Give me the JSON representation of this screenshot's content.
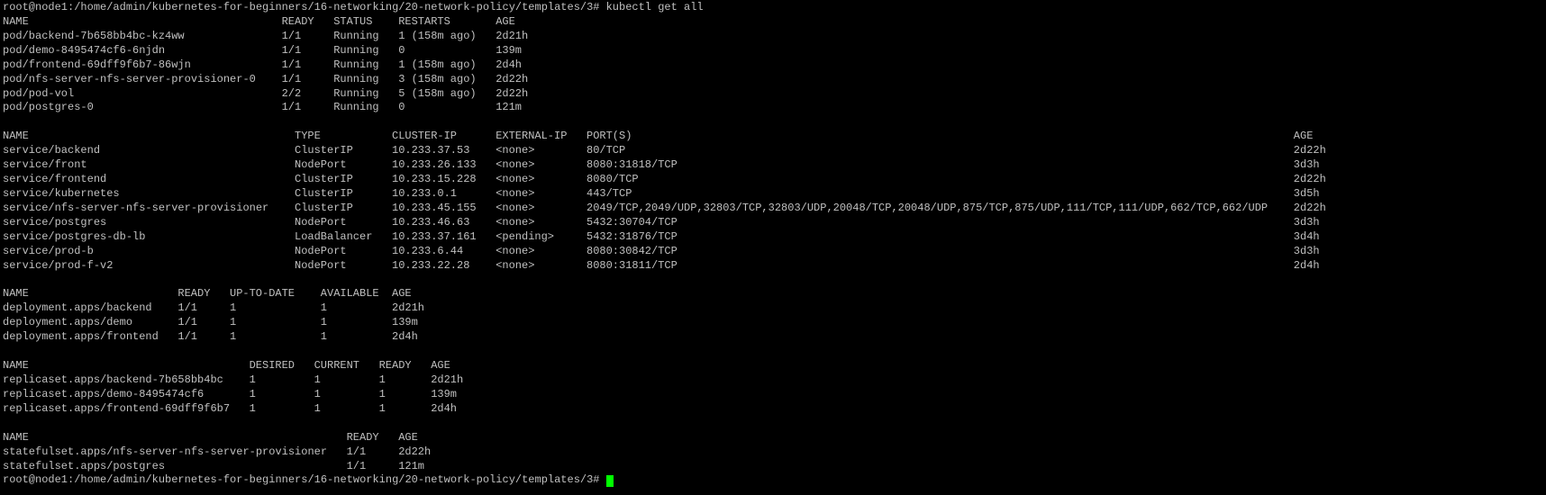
{
  "theme": {
    "background": "#000000",
    "foreground": "#c0c0c0",
    "cursor": "#00ff00"
  },
  "prompt": "root@node1:/home/admin/kubernetes-for-beginners/16-networking/20-network-policy/templates/3#",
  "command": "kubectl get all",
  "pods": {
    "headers": [
      "NAME",
      "READY",
      "STATUS",
      "RESTARTS",
      "AGE"
    ],
    "rows": [
      [
        "pod/backend-7b658bb4bc-kz4ww",
        "1/1",
        "Running",
        "1 (158m ago)",
        "2d21h"
      ],
      [
        "pod/demo-8495474cf6-6njdn",
        "1/1",
        "Running",
        "0",
        "139m"
      ],
      [
        "pod/frontend-69dff9f6b7-86wjn",
        "1/1",
        "Running",
        "1 (158m ago)",
        "2d4h"
      ],
      [
        "pod/nfs-server-nfs-server-provisioner-0",
        "1/1",
        "Running",
        "3 (158m ago)",
        "2d22h"
      ],
      [
        "pod/pod-vol",
        "2/2",
        "Running",
        "5 (158m ago)",
        "2d22h"
      ],
      [
        "pod/postgres-0",
        "1/1",
        "Running",
        "0",
        "121m"
      ]
    ]
  },
  "services": {
    "headers": [
      "NAME",
      "TYPE",
      "CLUSTER-IP",
      "EXTERNAL-IP",
      "PORT(S)",
      "AGE"
    ],
    "rows": [
      [
        "service/backend",
        "ClusterIP",
        "10.233.37.53",
        "<none>",
        "80/TCP",
        "2d22h"
      ],
      [
        "service/front",
        "NodePort",
        "10.233.26.133",
        "<none>",
        "8080:31818/TCP",
        "3d3h"
      ],
      [
        "service/frontend",
        "ClusterIP",
        "10.233.15.228",
        "<none>",
        "8080/TCP",
        "2d22h"
      ],
      [
        "service/kubernetes",
        "ClusterIP",
        "10.233.0.1",
        "<none>",
        "443/TCP",
        "3d5h"
      ],
      [
        "service/nfs-server-nfs-server-provisioner",
        "ClusterIP",
        "10.233.45.155",
        "<none>",
        "2049/TCP,2049/UDP,32803/TCP,32803/UDP,20048/TCP,20048/UDP,875/TCP,875/UDP,111/TCP,111/UDP,662/TCP,662/UDP",
        "2d22h"
      ],
      [
        "service/postgres",
        "NodePort",
        "10.233.46.63",
        "<none>",
        "5432:30704/TCP",
        "3d3h"
      ],
      [
        "service/postgres-db-lb",
        "LoadBalancer",
        "10.233.37.161",
        "<pending>",
        "5432:31876/TCP",
        "3d4h"
      ],
      [
        "service/prod-b",
        "NodePort",
        "10.233.6.44",
        "<none>",
        "8080:30842/TCP",
        "3d3h"
      ],
      [
        "service/prod-f-v2",
        "NodePort",
        "10.233.22.28",
        "<none>",
        "8080:31811/TCP",
        "2d4h"
      ]
    ]
  },
  "deployments": {
    "headers": [
      "NAME",
      "READY",
      "UP-TO-DATE",
      "AVAILABLE",
      "AGE"
    ],
    "rows": [
      [
        "deployment.apps/backend",
        "1/1",
        "1",
        "1",
        "2d21h"
      ],
      [
        "deployment.apps/demo",
        "1/1",
        "1",
        "1",
        "139m"
      ],
      [
        "deployment.apps/frontend",
        "1/1",
        "1",
        "1",
        "2d4h"
      ]
    ]
  },
  "replicasets": {
    "headers": [
      "NAME",
      "DESIRED",
      "CURRENT",
      "READY",
      "AGE"
    ],
    "rows": [
      [
        "replicaset.apps/backend-7b658bb4bc",
        "1",
        "1",
        "1",
        "2d21h"
      ],
      [
        "replicaset.apps/demo-8495474cf6",
        "1",
        "1",
        "1",
        "139m"
      ],
      [
        "replicaset.apps/frontend-69dff9f6b7",
        "1",
        "1",
        "1",
        "2d4h"
      ]
    ]
  },
  "statefulsets": {
    "headers": [
      "NAME",
      "READY",
      "AGE"
    ],
    "rows": [
      [
        "statefulset.apps/nfs-server-nfs-server-provisioner",
        "1/1",
        "2d22h"
      ],
      [
        "statefulset.apps/postgres",
        "1/1",
        "121m"
      ]
    ]
  }
}
